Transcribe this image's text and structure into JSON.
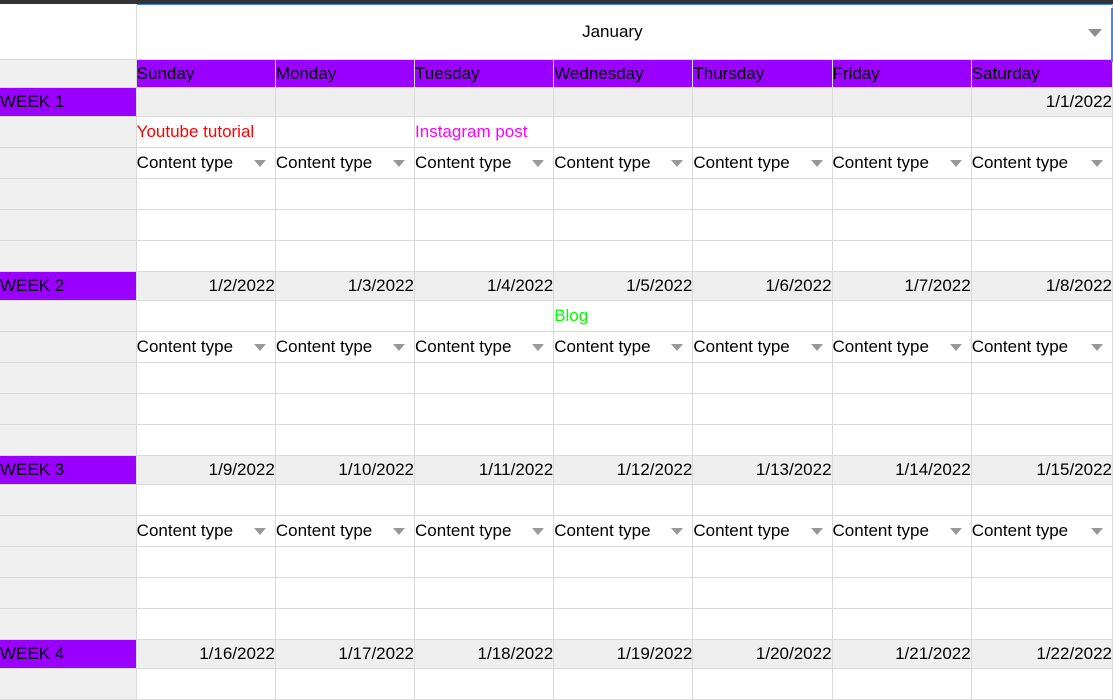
{
  "app": {
    "month_title": "January",
    "month_caret_icon": "chevron-down-icon",
    "accent_purple": "#9900ff",
    "selection_blue": "#4285f4",
    "header_gray": "#efefef"
  },
  "day_headers": [
    "Sunday",
    "Monday",
    "Tuesday",
    "Wednesday",
    "Thursday",
    "Friday",
    "Saturday"
  ],
  "content_type_label": "Content type",
  "content_type_caret_icon": "chevron-down-icon",
  "topic_colors": {
    "youtube": "#ff0000",
    "instagram": "#ff00ff",
    "blog": "#00ff00"
  },
  "weeks": [
    {
      "label": "WEEK 1",
      "dates": [
        "",
        "",
        "",
        "",
        "",
        "",
        "1/1/2022"
      ],
      "topics": [
        {
          "text": "Youtube tutorial",
          "color": "#ff0000"
        },
        {
          "text": "",
          "color": "#000000"
        },
        {
          "text": "Instagram post",
          "color": "#ff00ff"
        },
        {
          "text": "",
          "color": "#000000"
        },
        {
          "text": "",
          "color": "#000000"
        },
        {
          "text": "",
          "color": "#000000"
        },
        {
          "text": "",
          "color": "#000000"
        }
      ],
      "types": [
        "Content type",
        "Content type",
        "Content type",
        "Content type",
        "Content type",
        "Content type",
        "Content type"
      ],
      "empty_rows": 3
    },
    {
      "label": "WEEK 2",
      "dates": [
        "1/2/2022",
        "1/3/2022",
        "1/4/2022",
        "1/5/2022",
        "1/6/2022",
        "1/7/2022",
        "1/8/2022"
      ],
      "topics": [
        {
          "text": "",
          "color": "#000000"
        },
        {
          "text": "",
          "color": "#000000"
        },
        {
          "text": "",
          "color": "#000000"
        },
        {
          "text": "Blog",
          "color": "#00ff00"
        },
        {
          "text": "",
          "color": "#000000"
        },
        {
          "text": "",
          "color": "#000000"
        },
        {
          "text": "",
          "color": "#000000"
        }
      ],
      "types": [
        "Content type",
        "Content type",
        "Content type",
        "Content type",
        "Content type",
        "Content type",
        "Content type"
      ],
      "empty_rows": 3
    },
    {
      "label": "WEEK 3",
      "dates": [
        "1/9/2022",
        "1/10/2022",
        "1/11/2022",
        "1/12/2022",
        "1/13/2022",
        "1/14/2022",
        "1/15/2022"
      ],
      "topics": [
        {
          "text": "",
          "color": "#000000"
        },
        {
          "text": "",
          "color": "#000000"
        },
        {
          "text": "",
          "color": "#000000"
        },
        {
          "text": "",
          "color": "#000000"
        },
        {
          "text": "",
          "color": "#000000"
        },
        {
          "text": "",
          "color": "#000000"
        },
        {
          "text": "",
          "color": "#000000"
        }
      ],
      "types": [
        "Content type",
        "Content type",
        "Content type",
        "Content type",
        "Content type",
        "Content type",
        "Content type"
      ],
      "empty_rows": 3
    },
    {
      "label": "WEEK 4",
      "dates": [
        "1/16/2022",
        "1/17/2022",
        "1/18/2022",
        "1/19/2022",
        "1/20/2022",
        "1/21/2022",
        "1/22/2022"
      ],
      "topics": [
        {
          "text": "",
          "color": "#000000"
        },
        {
          "text": "",
          "color": "#000000"
        },
        {
          "text": "",
          "color": "#000000"
        },
        {
          "text": "",
          "color": "#000000"
        },
        {
          "text": "",
          "color": "#000000"
        },
        {
          "text": "",
          "color": "#000000"
        },
        {
          "text": "",
          "color": "#000000"
        }
      ],
      "types": [],
      "empty_rows": 0
    }
  ]
}
